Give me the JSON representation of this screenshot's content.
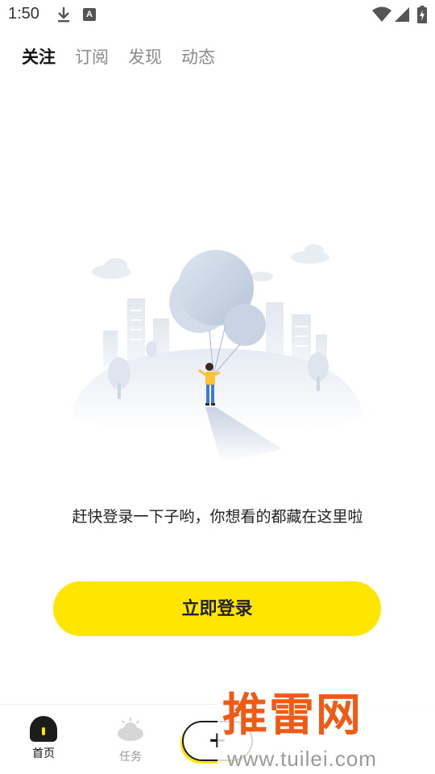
{
  "status_bar": {
    "time": "1:50",
    "icons": [
      "download-icon",
      "a-notification-icon",
      "wifi-icon",
      "signal-icon",
      "battery-charging-icon"
    ],
    "notification_letter": "A"
  },
  "tabs": [
    {
      "label": "关注",
      "active": true
    },
    {
      "label": "订阅",
      "active": false
    },
    {
      "label": "发现",
      "active": false
    },
    {
      "label": "动态",
      "active": false
    }
  ],
  "empty_state": {
    "illustration": "balloon-boy-illustration",
    "message": "赶快登录一下子哟，你想看的都藏在这里啦"
  },
  "login_button": {
    "label": "立即登录"
  },
  "bottom_nav": {
    "items": [
      {
        "label": "首页",
        "icon": "home-icon",
        "active": true
      },
      {
        "label": "任务",
        "icon": "cloud-sun-icon",
        "active": false
      }
    ],
    "add_button": {
      "label": "+"
    }
  },
  "watermark": {
    "logo": "推雷网",
    "url": "www.tuilei.com"
  },
  "colors": {
    "accent": "#ffe600",
    "watermark": "#f05a14"
  }
}
